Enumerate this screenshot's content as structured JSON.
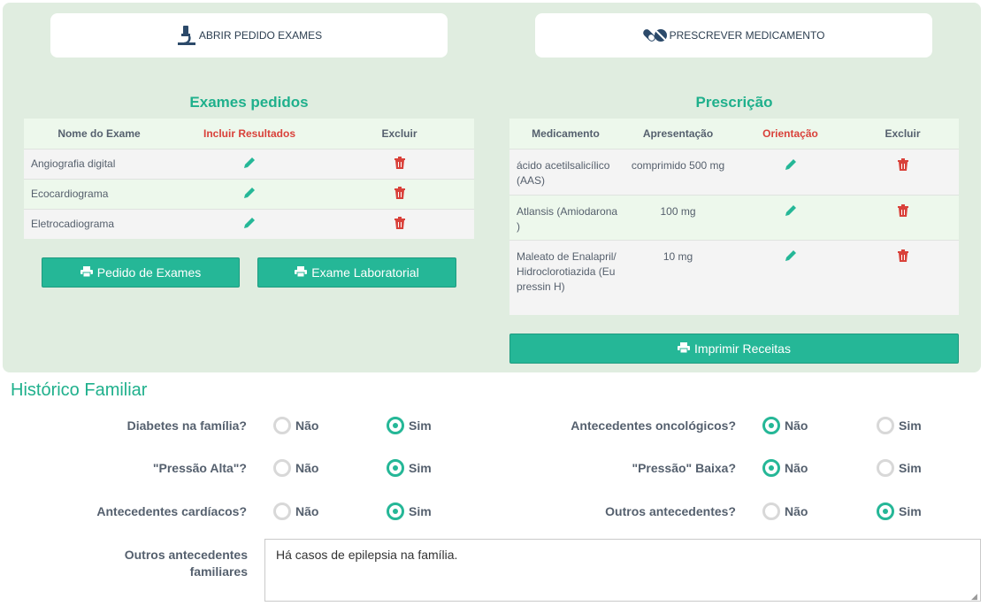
{
  "top_buttons": {
    "exams": "ABRIR PEDIDO EXAMES",
    "medication": "PRESCREVER MEDICAMENTO"
  },
  "exams": {
    "title": "Exames pedidos",
    "headers": [
      "Nome do Exame",
      "Incluir Resultados",
      "Excluir"
    ],
    "rows": [
      "Angiografia digital",
      "Ecocardiograma",
      "Eletrocadiograma"
    ],
    "btn_request": "Pedido de Exames",
    "btn_lab": "Exame Laboratorial"
  },
  "prescription": {
    "title": "Prescrição",
    "headers": [
      "Medicamento",
      "Apresentação",
      "Orientação",
      "Excluir"
    ],
    "rows": [
      {
        "med": "ácido acetilsalicílico (AAS)",
        "pres": "comprimido 500 mg"
      },
      {
        "med": "Atlansis (Amiodarona )",
        "pres": "100 mg"
      },
      {
        "med": "Maleato de Enalapril/Hidroclorotiazida (Eupressin H)",
        "pres": "10 mg"
      }
    ],
    "btn_print": "Imprimir Receitas"
  },
  "history": {
    "title": "Histórico Familiar",
    "no": "Não",
    "yes": "Sim",
    "left_questions": [
      {
        "label": "Diabetes na família?",
        "value": "Sim"
      },
      {
        "label": "\"Pressão Alta\"?",
        "value": "Sim"
      },
      {
        "label": "Antecedentes cardíacos?",
        "value": "Sim"
      }
    ],
    "right_questions": [
      {
        "label": "Antecedentes oncológicos?",
        "value": "Não"
      },
      {
        "label": "\"Pressão\" Baixa?",
        "value": "Não"
      },
      {
        "label": "Outros antecedentes?",
        "value": "Sim"
      }
    ],
    "other_label": "Outros antecedentes familiares",
    "other_value": "Há casos de epilepsia na família."
  },
  "colors": {
    "accent": "#25b797",
    "title_green": "#1fb08c",
    "panel_bg": "#e0ede0",
    "danger": "#d9413a"
  }
}
